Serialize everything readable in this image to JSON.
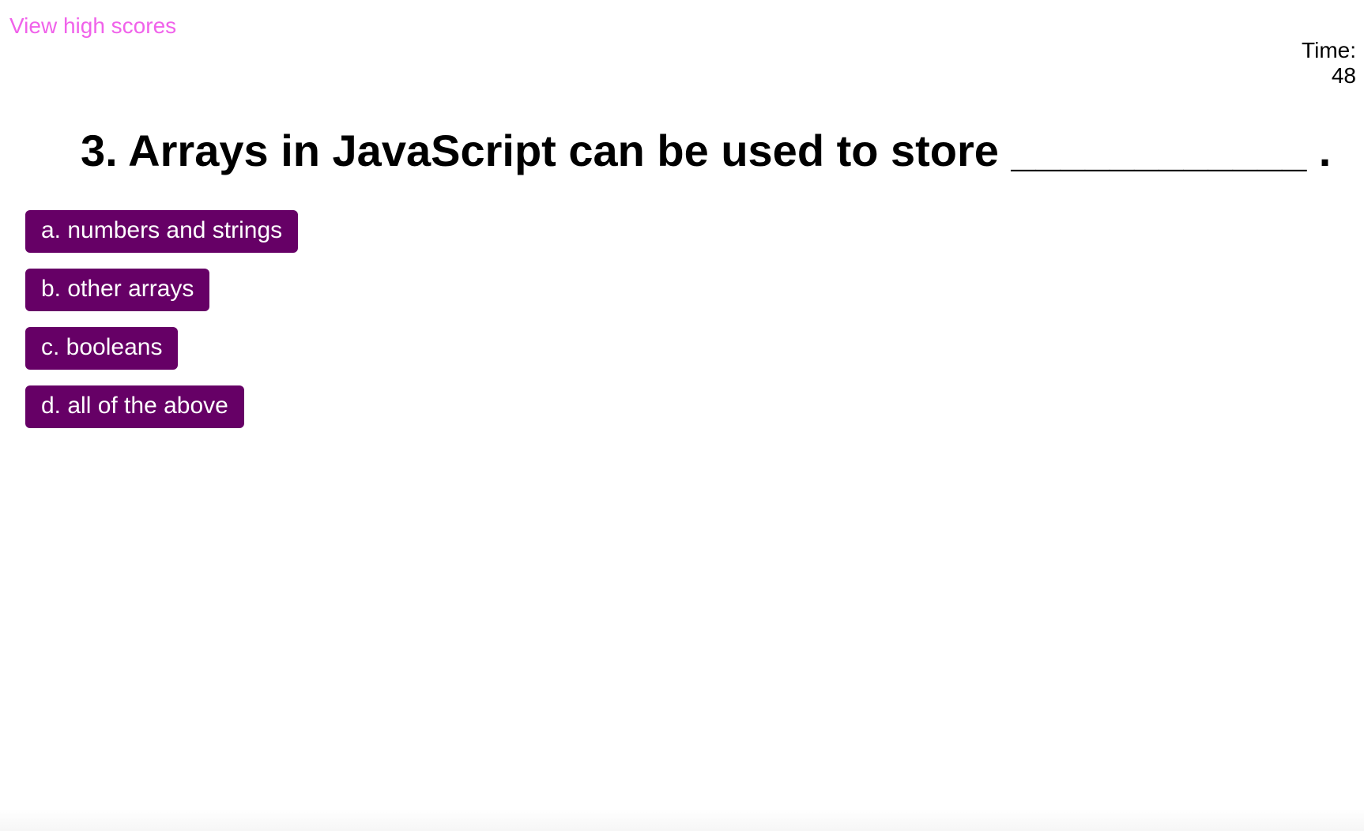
{
  "header": {
    "high_scores_label": "View high scores",
    "timer_label": "Time:",
    "timer_value": "48"
  },
  "quiz": {
    "question": "3. Arrays in JavaScript can be used to store ____________ .",
    "choices": [
      {
        "label": "a. numbers and strings"
      },
      {
        "label": "b. other arrays"
      },
      {
        "label": "c. booleans"
      },
      {
        "label": "d. all of the above"
      }
    ]
  },
  "colors": {
    "link": "#f062ea",
    "button_bg": "#660066",
    "button_text": "#ffffff",
    "text": "#000000",
    "background": "#ffffff"
  }
}
